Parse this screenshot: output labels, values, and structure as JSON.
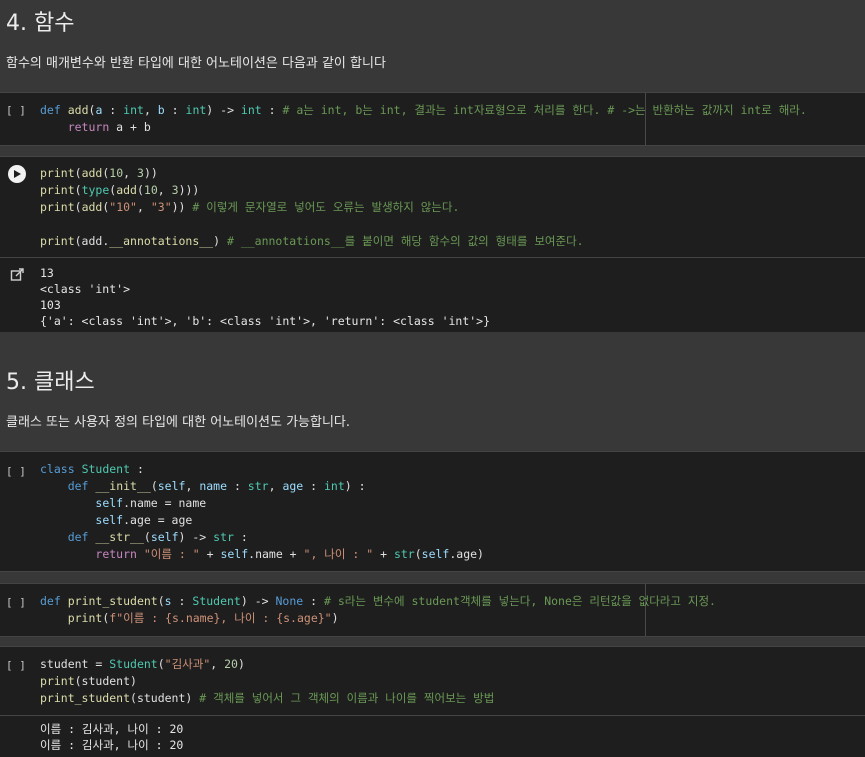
{
  "section4": {
    "heading": "4. 함수",
    "desc": "함수의 매개변수와 반환 타입에 대한 어노테이션은 다음과 같이 합니다"
  },
  "section5": {
    "heading": "5. 클래스",
    "desc": "클래스 또는 사용자 정의 타입에 대한 어노테이션도 가능합니다."
  },
  "gutter_empty": "[ ]",
  "cell_add": {
    "comment": "# a는 int, b는 int, 결과는 int자료형으로 처리를 한다. # ->는 반환하는 값까지 int로 해라."
  },
  "cell_print": {
    "comment1": "# 이렇게 문자열로 넣어도 오류는 발생하지 않는다.",
    "comment2": "# __annotations__를 붙이면 해당 함수의 값의 형태를 보여준다.",
    "outputs": [
      "13",
      "<class 'int'>",
      "103",
      "{'a': <class 'int'>, 'b': <class 'int'>, 'return': <class 'int'>}"
    ]
  },
  "cell_student": {
    "str_literal1": "\"이름 : \"",
    "str_literal2": "\", 나이 : \""
  },
  "cell_print_student": {
    "comment": "# s라는 변수에 student객체를 넣는다, None은 리턴값을 없다라고 지정.",
    "fstring": "f\"이름 : {s.name}, 나이 : {s.age}\""
  },
  "cell_create": {
    "str_literal": "\"김사과\"",
    "comment": "# 객체를 넣어서 그 객체의 이름과 나이를 찍어보는 방법",
    "outputs": [
      "이름 : 김사과, 나이 : 20",
      "이름 : 김사과, 나이 : 20"
    ]
  }
}
